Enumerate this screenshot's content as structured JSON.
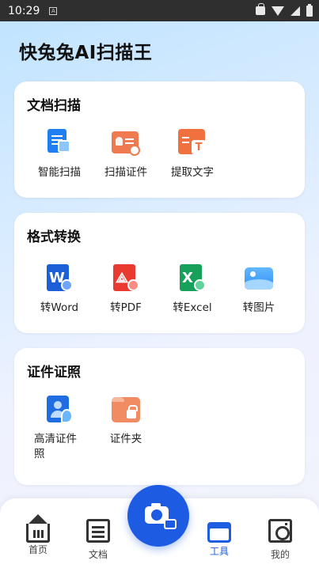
{
  "status_bar": {
    "time": "10:29",
    "notif_letter": "A"
  },
  "app_title": "快兔兔AI扫描王",
  "sections": [
    {
      "title": "文档扫描",
      "items": [
        {
          "label": "智能扫描",
          "icon": "smart-scan-icon"
        },
        {
          "label": "扫描证件",
          "icon": "id-scan-icon"
        },
        {
          "label": "提取文字",
          "icon": "extract-text-icon"
        }
      ]
    },
    {
      "title": "格式转换",
      "items": [
        {
          "label": "转Word",
          "icon": "word-icon",
          "letter": "W"
        },
        {
          "label": "转PDF",
          "icon": "pdf-icon",
          "letter": "⟁"
        },
        {
          "label": "转Excel",
          "icon": "excel-icon",
          "letter": "X"
        },
        {
          "label": "转图片",
          "icon": "image-icon"
        }
      ]
    },
    {
      "title": "证件证照",
      "items": [
        {
          "label": "高清证件照",
          "icon": "hd-photo-icon"
        },
        {
          "label": "证件夹",
          "icon": "folder-lock-icon"
        }
      ]
    }
  ],
  "extract_text_glyph": "T",
  "bottom_nav": [
    {
      "label": "首页",
      "icon": "home-icon",
      "active": false
    },
    {
      "label": "文档",
      "icon": "documents-icon",
      "active": false
    },
    {
      "label": "工具",
      "icon": "tools-icon",
      "active": true
    },
    {
      "label": "我的",
      "icon": "profile-icon",
      "active": false
    }
  ],
  "colors": {
    "accent": "#1d5be3",
    "word": "#1c5fd6",
    "pdf": "#e83a30",
    "excel": "#16a05a",
    "orange": "#f0703e"
  }
}
